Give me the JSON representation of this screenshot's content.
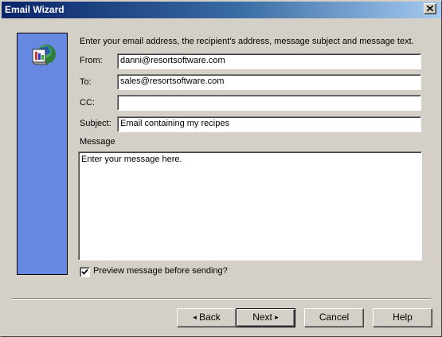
{
  "window": {
    "title": "Email Wizard"
  },
  "icons": {
    "close": "close-icon",
    "wizard": "email-wizard-icon",
    "checkmark": "checkmark-icon"
  },
  "form": {
    "instructions": "Enter your email address, the recipient's address, message subject and message text.",
    "from_label": "From:",
    "from_value": "danni@resortsoftware.com",
    "to_label": "To:",
    "to_value": "sales@resortsoftware.com",
    "cc_label": "CC:",
    "cc_value": "",
    "subject_label": "Subject:",
    "subject_value": "Email containing my recipes",
    "message_label": "Message",
    "message_value": "Enter your message here.",
    "preview_label": "Preview message before sending?",
    "preview_checked": true
  },
  "buttons": {
    "back": "Back",
    "next": "Next",
    "cancel": "Cancel",
    "help": "Help"
  },
  "colors": {
    "title_gradient_start": "#0a246a",
    "title_gradient_end": "#a6caf0",
    "side_panel": "#6688e0",
    "dialog_face": "#d4d0c8"
  }
}
